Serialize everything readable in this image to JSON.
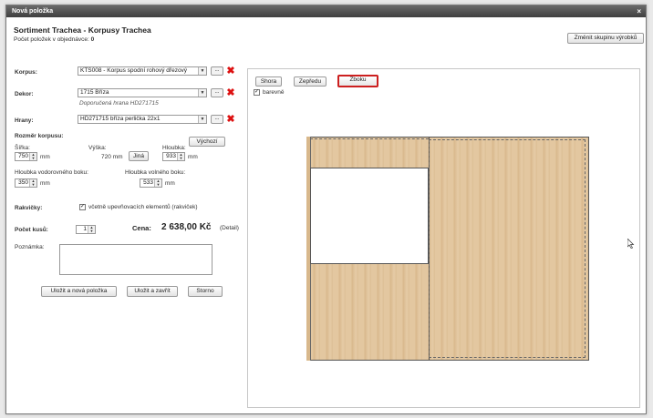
{
  "window": {
    "title": "Nová položka",
    "close_icon": "×"
  },
  "header": {
    "title": "Sortiment Trachea - Korpusy Trachea",
    "order_count_label": "Počet položek v objednávce:",
    "order_count_value": "0",
    "change_group_button": "Změnit skupinu výrobků"
  },
  "form": {
    "korpus": {
      "label": "Korpus:",
      "value": "KTS008 - Korpus spodní rohový dřezový"
    },
    "dekor": {
      "label": "Dekor:",
      "value": "1715 Bříza",
      "hint": "Doporučená hrana HD271715"
    },
    "hrany": {
      "label": "Hrany:",
      "value": "HD271715 bříza perlička 22x1"
    },
    "dots_label": "...",
    "size": {
      "title": "Rozměr korpusu:",
      "reset_button": "Výchozí",
      "width_label": "Šířka:",
      "width_value": "750",
      "height_label": "Výška:",
      "height_value": "720 mm",
      "other_button": "Jiná",
      "depth_label": "Hloubka:",
      "depth_value": "933",
      "depth_horizontal_label": "Hloubka vodorovného boku:",
      "depth_horizontal_value": "350",
      "depth_free_label": "Hloubka volného boku:",
      "depth_free_value": "533",
      "unit": "mm"
    },
    "rakvicky": {
      "label": "Rakvičky:",
      "checkbox_label": "včetně upevňovacích elementů (rakviček)",
      "checked": true
    },
    "count": {
      "label": "Počet kusů:",
      "value": "1"
    },
    "price": {
      "label": "Cena:",
      "value": "2 638,00 Kč",
      "detail_link": "(Detail)"
    },
    "note": {
      "label": "Poznámka:",
      "value": ""
    },
    "buttons": {
      "save_new": "Uložit a nová položka",
      "save_close": "Uložit a zavřít",
      "cancel": "Storno"
    }
  },
  "preview": {
    "tabs": [
      "Shora",
      "Zepředu",
      "Zboku"
    ],
    "active_tab": "Zboku",
    "color_checkbox_label": "barevně",
    "color_checked": true,
    "wood_color": "#e3c7a0",
    "active_tab_border": "#cc1f1f"
  }
}
